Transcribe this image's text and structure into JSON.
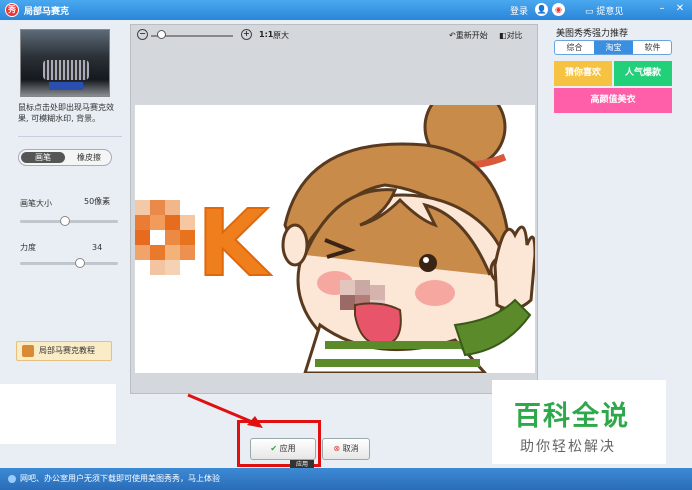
{
  "window": {
    "title": "局部马赛克",
    "login": "登录",
    "feedback": "提意见",
    "minimize": "–",
    "close": "✕"
  },
  "left": {
    "hint": "鼠标点击处即出现马赛克效果, 可模糊水印, 背景。",
    "brush_tab": "画笔",
    "eraser_tab": "橡皮擦",
    "brush_size_label": "画笔大小",
    "brush_size_value": "50像素",
    "brush_size_level": 0.45,
    "strength_label": "力度",
    "strength_value": "34",
    "strength_level": 0.62,
    "tutorial": "局部马赛克教程"
  },
  "toolbar": {
    "zoom_ratio": "1:1",
    "original": "原大",
    "reset": "重新开始",
    "compare": "对比"
  },
  "buttons": {
    "apply": "应用",
    "cancel": "取消",
    "tooltip": "应用"
  },
  "right": {
    "title": "美图秀秀强力推荐",
    "tabs": [
      "综合",
      "淘宝",
      "软件"
    ],
    "active_tab": 1,
    "promos": [
      "猜你喜欢",
      "人气爆款",
      "高颜值美衣"
    ],
    "colors": {
      "promo1": "#f5c242",
      "promo2": "#22d07a",
      "promo3": "#ff5fa8"
    }
  },
  "status": {
    "text": "网吧、办公室用户无须下载即可使用美图秀秀，马上体验"
  },
  "watermark": {
    "title": "百科全说",
    "subtitle": "助你轻松解决"
  },
  "photo": {
    "letter": "K"
  }
}
